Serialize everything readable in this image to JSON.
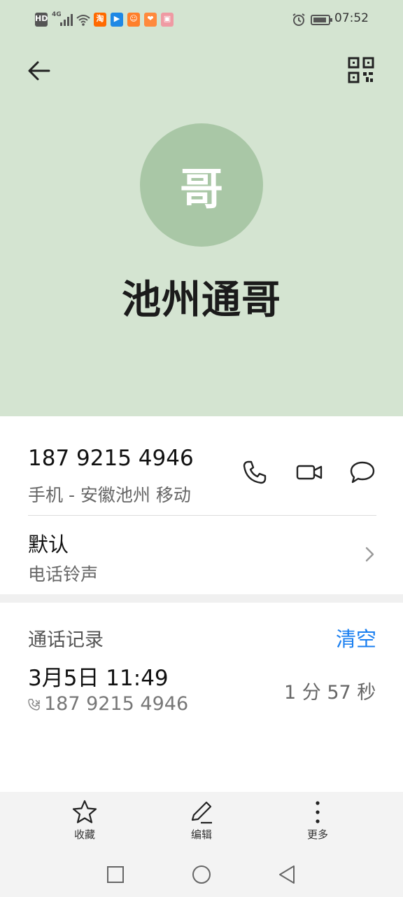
{
  "status_bar": {
    "time": "07:52",
    "network": "4G",
    "hd_badge": "HD",
    "app_badges": [
      {
        "name": "taobao-icon",
        "color": "#ff6a00",
        "glyph": "淘"
      },
      {
        "name": "messaging-app-icon",
        "color": "#1e88e5",
        "glyph": "▶"
      },
      {
        "name": "bilibili-like-icon",
        "color": "#ff7f2a",
        "glyph": "☺"
      },
      {
        "name": "heart-app-icon",
        "color": "#ff8a3d",
        "glyph": "❤"
      },
      {
        "name": "gift-app-icon",
        "color": "#ef9aa3",
        "glyph": "▣"
      }
    ]
  },
  "contact": {
    "avatar_char": "哥",
    "name": "池州通哥",
    "phone": "187 9215 4946",
    "phone_desc": "手机 - 安徽池州 移动"
  },
  "ringtone": {
    "value": "默认",
    "label": "电话铃声"
  },
  "history": {
    "title": "通话记录",
    "clear_label": "清空",
    "entries": [
      {
        "datetime": "3月5日 11:49",
        "number": "187 9215 4946",
        "duration": "1 分 57 秒"
      }
    ]
  },
  "bottom_bar": {
    "favorite_label": "收藏",
    "edit_label": "编辑",
    "more_label": "更多"
  },
  "colors": {
    "header_bg": "#d4e4d1",
    "avatar_bg": "#a9c7a6",
    "accent": "#1a7ff0"
  }
}
